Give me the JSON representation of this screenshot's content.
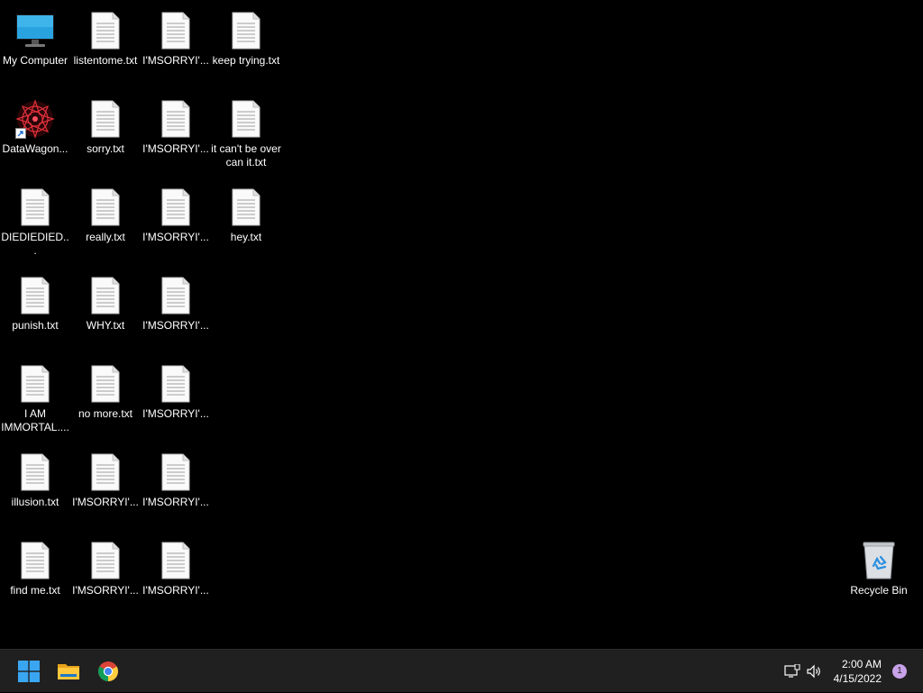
{
  "desktop": {
    "icons": [
      {
        "label": "My Computer",
        "type": "computer"
      },
      {
        "label": "listentome.txt",
        "type": "txt"
      },
      {
        "label": "I'MSORRYI'...",
        "type": "txt"
      },
      {
        "label": "keep trying.txt",
        "type": "txt"
      },
      {
        "label": "DataWagon...",
        "type": "shortcut"
      },
      {
        "label": "sorry.txt",
        "type": "txt"
      },
      {
        "label": "I'MSORRYI'...",
        "type": "txt"
      },
      {
        "label": "it can't be over can it.txt",
        "type": "txt"
      },
      {
        "label": "DIEDIEDIED...",
        "type": "txt"
      },
      {
        "label": "really.txt",
        "type": "txt"
      },
      {
        "label": "I'MSORRYI'...",
        "type": "txt"
      },
      {
        "label": "hey.txt",
        "type": "txt"
      },
      {
        "label": "punish.txt",
        "type": "txt"
      },
      {
        "label": "WHY.txt",
        "type": "txt"
      },
      {
        "label": "I'MSORRYI'...",
        "type": "txt"
      },
      {
        "label": "I AM IMMORTAL....",
        "type": "txt"
      },
      {
        "label": "no more.txt",
        "type": "txt"
      },
      {
        "label": "I'MSORRYI'...",
        "type": "txt"
      },
      {
        "label": "illusion.txt",
        "type": "txt"
      },
      {
        "label": "I'MSORRYI'...",
        "type": "txt"
      },
      {
        "label": "I'MSORRYI'...",
        "type": "txt"
      },
      {
        "label": "find me.txt",
        "type": "txt"
      },
      {
        "label": "I'MSORRYI'...",
        "type": "txt"
      },
      {
        "label": "I'MSORRYI'...",
        "type": "txt"
      },
      {
        "label": "Recycle Bin",
        "type": "recycle"
      }
    ]
  },
  "taskbar": {
    "pinned": [
      {
        "name": "start-button",
        "icon": "windows-logo-icon"
      },
      {
        "name": "file-explorer-button",
        "icon": "folder-icon"
      },
      {
        "name": "chrome-button",
        "icon": "chrome-icon"
      }
    ],
    "tray": {
      "network_icon": "network-icon",
      "volume_icon": "volume-icon",
      "time": "2:00 AM",
      "date": "4/15/2022",
      "notification_count": "1"
    }
  },
  "colors": {
    "desktop_bg": "#000000",
    "taskbar_bg": "#202020",
    "notification_badge": "#c8a2e8"
  }
}
